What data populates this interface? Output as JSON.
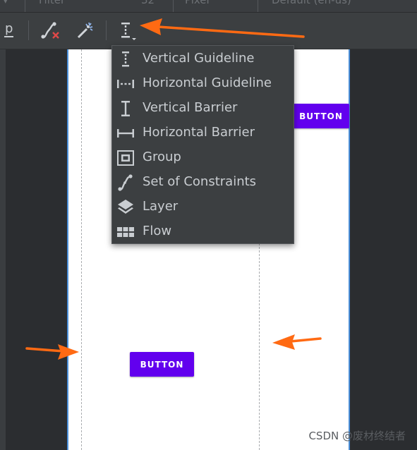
{
  "top_bar": {
    "items": [
      "Filter",
      "32",
      "Pixel",
      "Default (en-us)"
    ]
  },
  "toolbar": {
    "unit_label": "p",
    "icons": [
      "clear-constraints-icon",
      "infer-constraints-icon",
      "guidelines-menu-icon"
    ]
  },
  "menu": {
    "items": [
      {
        "label": "Vertical Guideline",
        "icon": "vertical-guideline-icon"
      },
      {
        "label": "Horizontal Guideline",
        "icon": "horizontal-guideline-icon"
      },
      {
        "label": "Vertical Barrier",
        "icon": "vertical-barrier-icon"
      },
      {
        "label": "Horizontal Barrier",
        "icon": "horizontal-barrier-icon"
      },
      {
        "label": "Group",
        "icon": "group-icon"
      },
      {
        "label": "Set of Constraints",
        "icon": "constraint-set-icon"
      },
      {
        "label": "Layer",
        "icon": "layer-icon"
      },
      {
        "label": "Flow",
        "icon": "flow-icon"
      }
    ]
  },
  "canvas": {
    "button_top_label": "BUTTON",
    "button_bottom_label": "BUTTON"
  },
  "watermark": "CSDN @废材终结者",
  "colors": {
    "button": "#6200ee",
    "annotation_arrow": "#ff6a13",
    "constraint_red": "#e04848"
  }
}
